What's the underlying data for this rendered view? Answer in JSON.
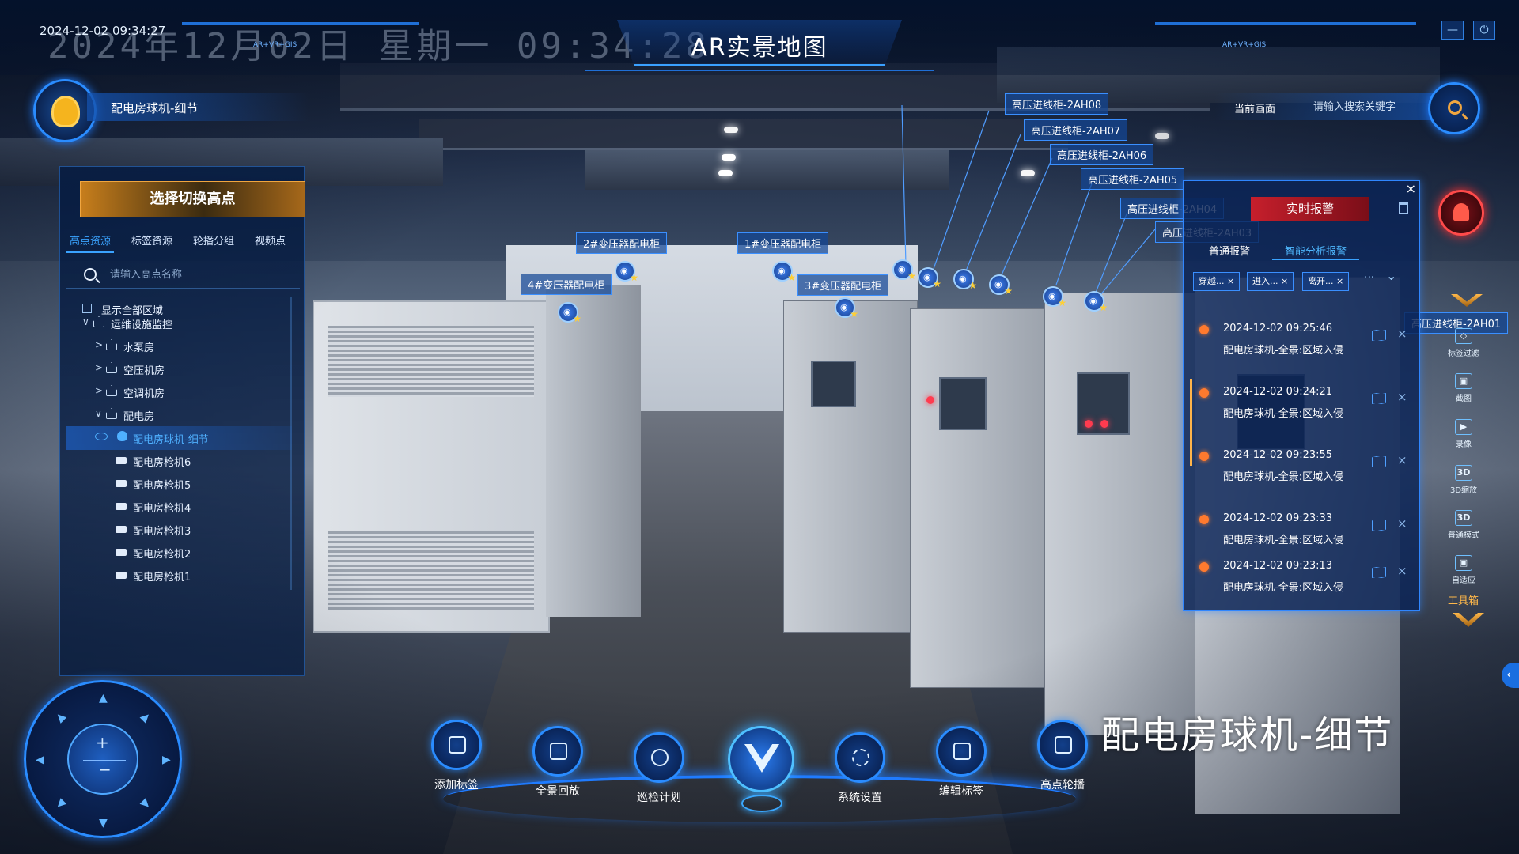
{
  "header": {
    "clock": "2024-12-02 09:34:27",
    "big_date": "2024年12月02日 星期一 09:34:28",
    "title": "AR实景地图",
    "small_tag": "AR+VR+GIS"
  },
  "location": {
    "label": "配电房球机-细节"
  },
  "left_panel": {
    "title": "选择切换高点",
    "tabs": [
      "高点资源",
      "标签资源",
      "轮播分组",
      "视频点"
    ],
    "active_tab": 0,
    "search_placeholder": "请输入高点名称",
    "tree": [
      {
        "label": "显示全部区域",
        "kind": "checkbox",
        "level": 0
      },
      {
        "label": "运维设施监控",
        "kind": "group",
        "level": 1,
        "caret": "∨"
      },
      {
        "label": "水泵房",
        "kind": "group",
        "level": 2,
        "caret": ">"
      },
      {
        "label": "空压机房",
        "kind": "group",
        "level": 2,
        "caret": ">"
      },
      {
        "label": "空调机房",
        "kind": "group",
        "level": 2,
        "caret": ">"
      },
      {
        "label": "配电房",
        "kind": "group",
        "level": 2,
        "caret": "∨"
      },
      {
        "label": "配电房球机-细节",
        "kind": "dome",
        "level": 3,
        "selected": true
      },
      {
        "label": "配电房枪机6",
        "kind": "camera",
        "level": 3
      },
      {
        "label": "配电房枪机5",
        "kind": "camera",
        "level": 3
      },
      {
        "label": "配电房枪机4",
        "kind": "camera",
        "level": 3
      },
      {
        "label": "配电房枪机3",
        "kind": "camera",
        "level": 3
      },
      {
        "label": "配电房枪机2",
        "kind": "camera",
        "level": 3
      },
      {
        "label": "配电房枪机1",
        "kind": "camera",
        "level": 3
      }
    ]
  },
  "scene_tags": [
    "2#变压器配电柜",
    "1#变压器配电柜",
    "4#变压器配电柜",
    "3#变压器配电柜",
    "高压进线柜-2AH08",
    "高压进线柜-2AH07",
    "高压进线柜-2AH06",
    "高压进线柜-2AH05",
    "高压进线柜-2AH04",
    "高压进线柜-2AH03",
    "高压进线柜-2AH01"
  ],
  "right_search": {
    "label": "当前画面",
    "placeholder": "请输入搜索关键字"
  },
  "alarm_panel": {
    "title": "实时报警",
    "close": "×",
    "tabs": [
      "普通报警",
      "智能分析报警"
    ],
    "active_tab": 1,
    "chips": [
      "穿越...",
      "进入...",
      "离开..."
    ],
    "more": "···",
    "items": [
      {
        "time": "2024-12-02 09:25:46",
        "desc": "配电房球机-全景:区域入侵"
      },
      {
        "time": "2024-12-02 09:24:21",
        "desc": "配电房球机-全景:区域入侵"
      },
      {
        "time": "2024-12-02 09:23:55",
        "desc": "配电房球机-全景:区域入侵"
      },
      {
        "time": "2024-12-02 09:23:33",
        "desc": "配电房球机-全景:区域入侵"
      },
      {
        "time": "2024-12-02 09:23:13",
        "desc": "配电房球机-全景:区域入侵"
      }
    ]
  },
  "tools": [
    {
      "label": "标签过滤",
      "icon": "◇"
    },
    {
      "label": "截图",
      "icon": "▣"
    },
    {
      "label": "录像",
      "icon": "▶"
    },
    {
      "label": "3D缩放",
      "icon": "3D"
    },
    {
      "label": "普通模式",
      "icon": "3D"
    },
    {
      "label": "自适应",
      "icon": "▣"
    }
  ],
  "toolbox_label": "工具箱",
  "bottom_buttons": [
    "添加标签",
    "全景回放",
    "巡检计划",
    "系统设置",
    "编辑标签",
    "高点轮播"
  ],
  "caption": "配电房球机-细节",
  "ptz": {
    "plus": "+",
    "minus": "−"
  },
  "colors": {
    "accent": "#2a8cff",
    "alarm": "#c61f2c",
    "orange": "#f0a640"
  }
}
